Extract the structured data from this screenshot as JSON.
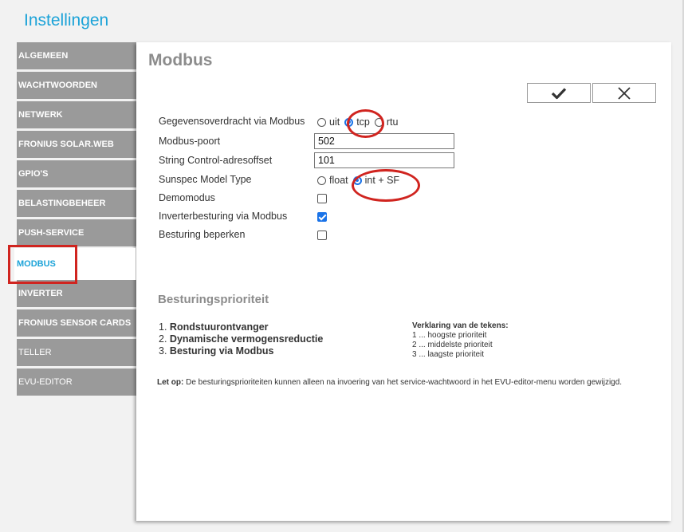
{
  "app": {
    "title": "Instellingen"
  },
  "sidebar": {
    "items": [
      {
        "label": "ALGEMEEN"
      },
      {
        "label": "WACHTWOORDEN"
      },
      {
        "label": "NETWERK"
      },
      {
        "label": "FRONIUS SOLAR.WEB"
      },
      {
        "label": "GPIO'S"
      },
      {
        "label": "BELASTINGBEHEER"
      },
      {
        "label": "PUSH-SERVICE"
      },
      {
        "label": "MODBUS"
      },
      {
        "label": "INVERTER"
      },
      {
        "label": "FRONIUS SENSOR CARDS"
      },
      {
        "label": "TELLER"
      },
      {
        "label": "EVU-EDITOR"
      }
    ],
    "active": "MODBUS"
  },
  "panel": {
    "title": "Modbus",
    "confirm_icon": "checkmark-icon",
    "cancel_icon": "close-icon"
  },
  "form": {
    "transfer": {
      "label": "Gegevensoverdracht via Modbus",
      "options": [
        "uit",
        "tcp",
        "rtu"
      ],
      "selected": "tcp"
    },
    "port": {
      "label": "Modbus-poort",
      "value": "502"
    },
    "offset": {
      "label": "String Control-adresoffset",
      "value": "101"
    },
    "sunspec": {
      "label": "Sunspec Model Type",
      "options": [
        "float",
        "int + SF"
      ],
      "selected": "int + SF"
    },
    "demo": {
      "label": "Demomodus",
      "checked": false
    },
    "inverter_control": {
      "label": "Inverterbesturing via Modbus",
      "checked": true
    },
    "limit_control": {
      "label": "Besturing beperken",
      "checked": false
    }
  },
  "priority": {
    "title": "Besturingsprioriteit",
    "items": [
      {
        "num": "1.",
        "label": "Rondstuurontvanger"
      },
      {
        "num": "2.",
        "label": "Dynamische vermogensreductie"
      },
      {
        "num": "3.",
        "label": "Besturing via Modbus"
      }
    ],
    "legend_title": "Verklaring van de tekens:",
    "legend": [
      "1 ... hoogste prioriteit",
      "2 ... middelste prioriteit",
      "3 ... laagste prioriteit"
    ]
  },
  "note": {
    "prefix": "Let op:",
    "text": " De besturingsprioriteiten kunnen alleen na invoering van het service-wachtwoord in het EVU-editor-menu worden gewijzigd."
  },
  "colors": {
    "accent": "#1ca3d8",
    "nav_bg": "#9a9a9a",
    "annotation": "#d0241f",
    "control": "#1a73e8"
  }
}
